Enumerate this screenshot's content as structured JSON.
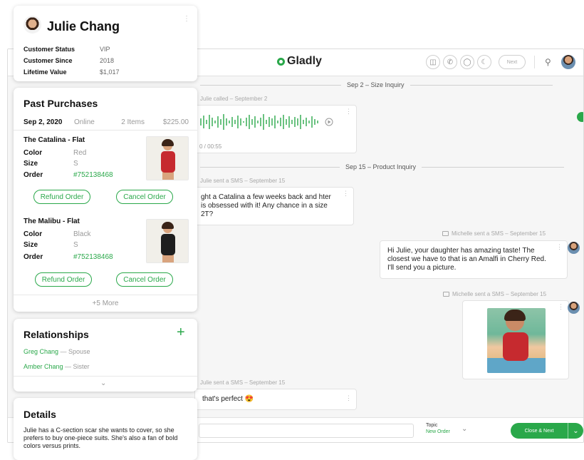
{
  "topbar": {
    "logo": "Gladly",
    "next_label": "Next"
  },
  "conversation": {
    "dividers": [
      "Sep 2 – Size Inquiry",
      "Sep 15 – Product Inquiry"
    ],
    "call_meta": "Julie called – September 2",
    "call_duration": "0 / 00:55",
    "sms1_meta": "Julie sent a SMS – September 15",
    "sms1_text": "ght a Catalina a few weeks back and hter is obsessed with it! Any chance in a size 2T?",
    "agent1_meta": "Michelle sent a SMS – September 15",
    "agent1_text": "Hi Julie, your daughter has amazing taste! The closest we have to that is an Amalfi in Cherry Red. I'll send you a picture.",
    "agent2_meta": "Michelle sent a SMS – September 15",
    "sms2_meta": "Julie sent a SMS – September 15",
    "sms2_text": "that's perfect 😍"
  },
  "composer": {
    "topic_label": "Topic",
    "topic_value": "New Order",
    "close_next_label": "Close & Next"
  },
  "customer": {
    "name": "Julie Chang",
    "fields": [
      {
        "label": "Customer Status",
        "value": "VIP"
      },
      {
        "label": "Customer Since",
        "value": "2018"
      },
      {
        "label": "Lifetime Value",
        "value": "$1,017"
      }
    ]
  },
  "purchases": {
    "title": "Past Purchases",
    "order": {
      "date": "Sep 2, 2020",
      "channel": "Online",
      "items": "2 Items",
      "total": "$225.00"
    },
    "products": [
      {
        "name": "The Catalina - Flat",
        "color_label": "Color",
        "color": "Red",
        "size_label": "Size",
        "size": "S",
        "order_label": "Order",
        "order": "#752138468",
        "refund": "Refund Order",
        "cancel": "Cancel Order",
        "swatch": "#c62a2f"
      },
      {
        "name": "The Malibu - Flat",
        "color_label": "Color",
        "color": "Black",
        "size_label": "Size",
        "size": "S",
        "order_label": "Order",
        "order": "#752138468",
        "refund": "Refund Order",
        "cancel": "Cancel Order",
        "swatch": "#1e1e1e"
      }
    ],
    "more": "+5 More"
  },
  "relationships": {
    "title": "Relationships",
    "items": [
      {
        "name": "Greg Chang",
        "relation": " — Spouse"
      },
      {
        "name": "Amber Chang",
        "relation": " — Sister"
      }
    ]
  },
  "details": {
    "title": "Details",
    "text": "Julie has a C-section scar she wants to cover, so she prefers to buy one-piece suits. She's also a fan of bold colors versus prints."
  },
  "colors": {
    "accent": "#2aa84a"
  }
}
